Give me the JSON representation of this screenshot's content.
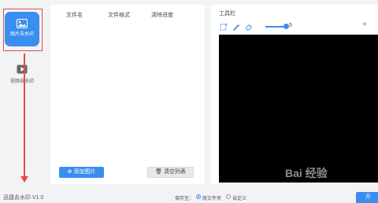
{
  "sidebar": {
    "items": [
      {
        "label": "图片去水印",
        "icon": "image-icon",
        "active": true
      },
      {
        "label": "视频去水印",
        "icon": "video-play-icon",
        "active": false
      }
    ]
  },
  "file_panel": {
    "columns": [
      "文件名",
      "文件格式",
      "清除进度"
    ],
    "add_label": "添加图片",
    "clear_label": "清空列表"
  },
  "tool_panel": {
    "title": "工具栏",
    "tools": [
      "select-rect-icon",
      "pen-icon",
      "eraser-icon"
    ],
    "brush_size": "5",
    "plus_label": "+"
  },
  "footer": {
    "version": "迅捷去水印 V1.0",
    "save_to": "保存至：",
    "options": [
      "原文件夹",
      "自定义"
    ],
    "selected_option": "原文件夹",
    "start_label": "开"
  },
  "watermark_text": "Bai 经验",
  "colors": {
    "accent": "#3a8ef0",
    "annotation": "#e34b4b"
  }
}
